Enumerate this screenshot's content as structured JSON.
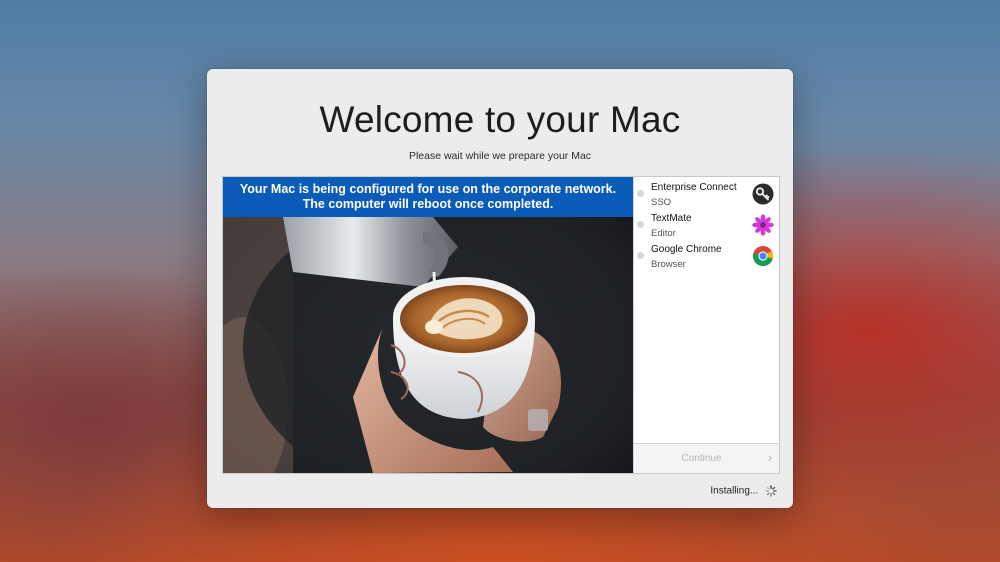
{
  "window": {
    "title": "Welcome to your Mac",
    "subtitle": "Please wait while we prepare your Mac"
  },
  "banner": {
    "line1": "Your Mac is being configured for use on the corporate network.",
    "line2": "The computer will reboot once completed.",
    "color": "#0b5cb8"
  },
  "apps": [
    {
      "name": "Enterprise Connect",
      "description": "SSO",
      "icon": "key-icon"
    },
    {
      "name": "TextMate",
      "description": "Editor",
      "icon": "flower-icon"
    },
    {
      "name": "Google Chrome",
      "description": "Browser",
      "icon": "chrome-icon"
    }
  ],
  "actions": {
    "continue_label": "Continue"
  },
  "status": {
    "text": "Installing...",
    "icon": "spinner-icon"
  }
}
